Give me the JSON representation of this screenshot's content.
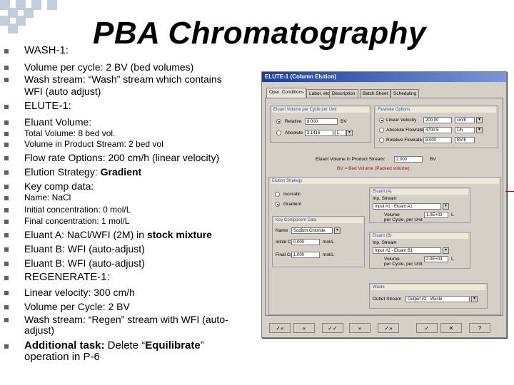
{
  "title": "PBA Chromatography",
  "bullets": [
    {
      "text": "WASH-1:",
      "size": 15
    },
    {
      "text": "Volume per cycle: 2 BV (bed volumes)",
      "size": 14
    },
    {
      "text": "Wash stream: “Wash” stream which contains",
      "size": 14
    },
    {
      "text": "WFI (auto adjust)",
      "size": 14,
      "cont": true
    },
    {
      "text": "ELUTE-1:",
      "size": 15
    },
    {
      "text": "Eluant Volume:",
      "size": 14
    },
    {
      "text": "Total Volume: 8 bed vol.",
      "size": 12
    },
    {
      "text": "Volume in Product Stream: 2 bed vol",
      "size": 12
    },
    {
      "text": "Flow rate Options: 200 cm/h (linear velocity)",
      "size": 14
    },
    {
      "text": "Elution Strategy: Gradient",
      "size": 14
    },
    {
      "text": "Key comp data:",
      "size": 14
    },
    {
      "text": "Name: NaCl",
      "size": 12
    },
    {
      "text": "Initial concentration: 0 mol/L",
      "size": 12
    },
    {
      "text": "Final concentration: 1 mol/L",
      "size": 12
    },
    {
      "text": "Eluant A: NaCl/WFI (2M) in stock mixture",
      "size": 14
    },
    {
      "text": "Eluant B: WFI (auto-adjust)",
      "size": 14
    },
    {
      "text": "Eluant B: WFI (auto-adjust)",
      "size": 14
    },
    {
      "text": "REGENERATE-1:",
      "size": 15
    },
    {
      "text": "Linear velocity: 300 cm/h",
      "size": 14
    },
    {
      "text": "Volume per Cycle: 2 BV",
      "size": 14
    },
    {
      "text": "Wash stream: “Regen” stream with WFI (auto-",
      "size": 14
    },
    {
      "text": "adjust)",
      "size": 14,
      "cont": true
    },
    {
      "text": "Additional task: Delete “Equilibrate”",
      "size": 15
    },
    {
      "text": "operation in P-6",
      "size": 15,
      "cont": true
    }
  ],
  "dialog": {
    "title": "ELUTE-1 (Column Elution)",
    "tabs": [
      "Oper. Conditions",
      "Labor, etc.",
      "Description",
      "Batch Sheet",
      "Scheduling"
    ],
    "eluant_volume_group": "Eluant Volume per Cycle per Unit",
    "relative_label": "Relative",
    "relative_value": "8.000",
    "relative_unit": "BV",
    "absolute_label": "Absolute",
    "absolute_value": "3.1416",
    "absolute_unit": "L",
    "flowrate_group": "Flowrate Options",
    "linear_velocity_label": "Linear Velocity",
    "linear_velocity_value": "200.00",
    "linear_velocity_unit": "cm/h",
    "absolute_flowrate_label": "Absolute Flowrate",
    "absolute_flowrate_value": "4700.5",
    "absolute_flowrate_unit": "L/h",
    "relative_flowrate_label": "Relative Flowrate",
    "relative_flowrate_value": "8.000",
    "relative_flowrate_unit": "BV/h",
    "product_stream_label": "Eluant Volume in Product Stream:",
    "product_stream_value": "2.000",
    "product_stream_unit": "BV",
    "product_stream_note": "BV = Bed Volume (Packed volume)",
    "elution_strategy_group": "Elution Strategy",
    "isocratic_label": "Isocratic",
    "gradient_label": "Gradient",
    "eluant_a_group": "Eluant (A)",
    "eluant_a_in_stream": "Inp. Stream",
    "eluant_a_stream_value": "Input #1 - Eluant A1",
    "eluant_a_volume_label": "Volume",
    "eluant_a_volume_value": "1.0E+03",
    "eluant_a_volume_unit": "L",
    "per_cycle_label": "per Cycle, per Unit",
    "key_comp_group": "Key Component Data",
    "name_label": "Name",
    "name_value": "Sodium Chloride",
    "initial_conc_label": "Initial Conc.",
    "initial_conc_value": "0.000",
    "initial_conc_unit": "mol/L",
    "final_conc_label": "Final Conc.",
    "final_conc_value": "1.000",
    "final_conc_unit": "mol/L",
    "eluant_b_group": "Eluant (B)",
    "eluant_b_in_stream": "Inp. Stream",
    "eluant_b_stream_value": "Input #2 - Eluant B1",
    "eluant_b_volume_label": "Volume",
    "eluant_b_volume_value": "2.0E+03",
    "eluant_b_volume_unit": "L",
    "waste_group": "Waste",
    "outlet_stream_label": "Outlet Stream",
    "outlet_stream_value": "Output #2 - Waste",
    "bottom_buttons": [
      "✓«",
      "«",
      "✓✓",
      "»",
      "✓»",
      "✓",
      "✕",
      "?"
    ]
  }
}
